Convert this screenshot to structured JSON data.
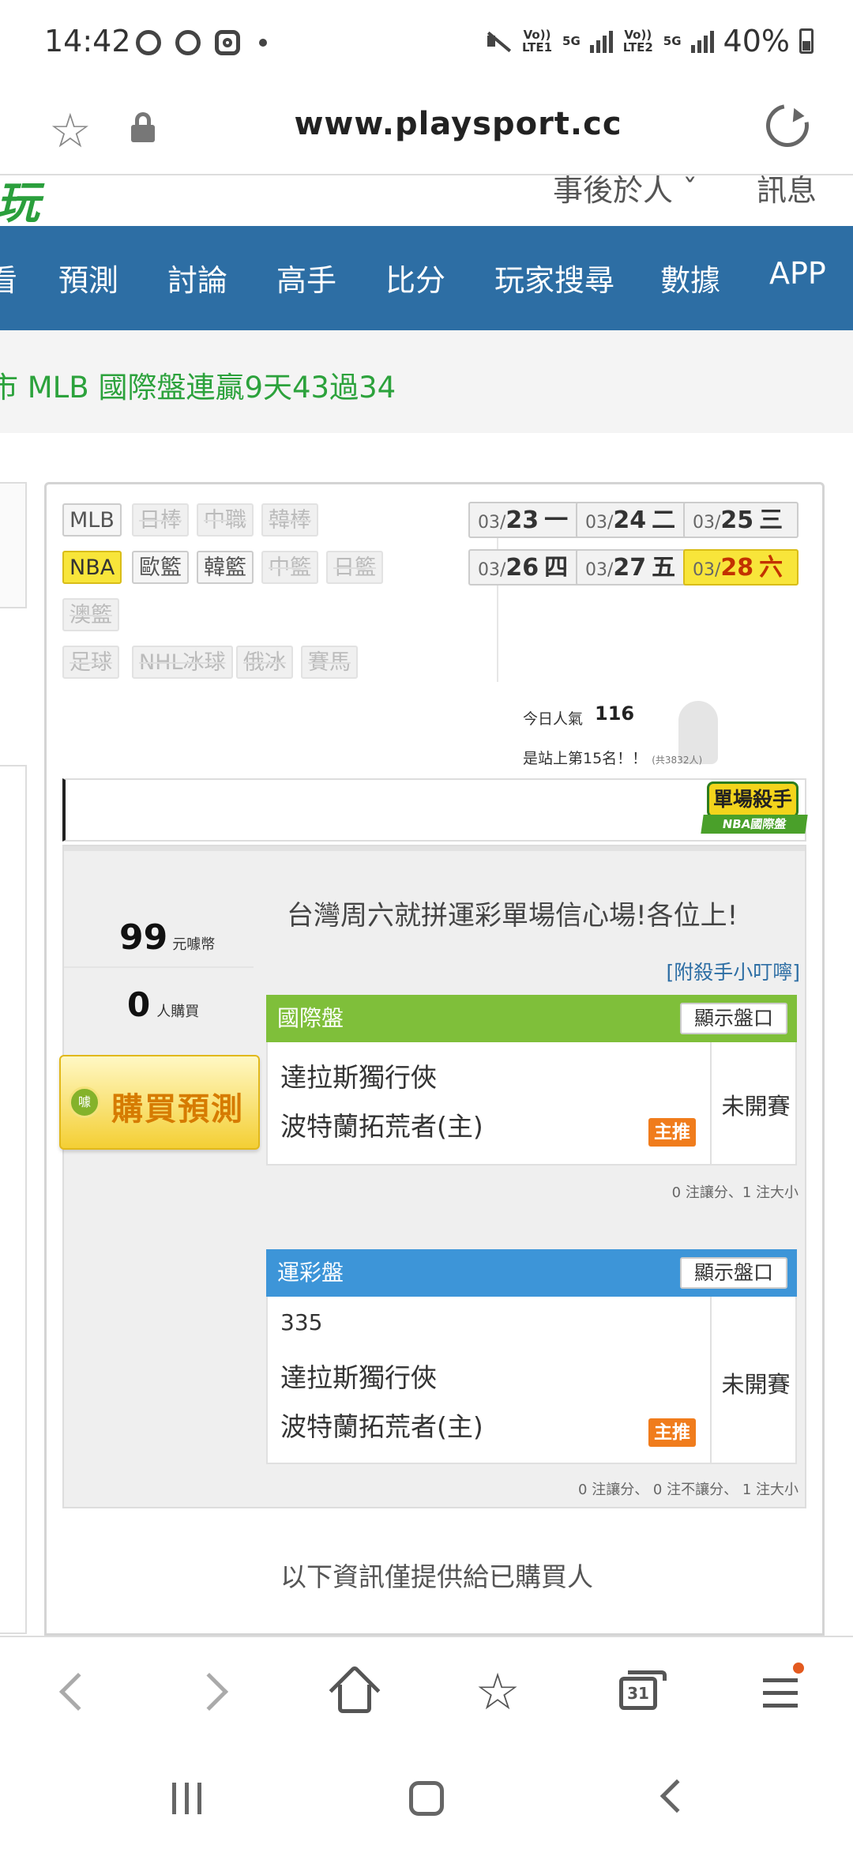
{
  "status_bar": {
    "time": "14:42",
    "sim1": "Vo)) LTE1",
    "sim2": "Vo)) LTE2",
    "net1": "5G",
    "net2": "5G",
    "battery": "40%"
  },
  "browser": {
    "url": "www.playsport.cc"
  },
  "site_header": {
    "link1": "事後於人 ˇ",
    "link2": "訊息"
  },
  "nav": [
    "看",
    "預測",
    "討論",
    "高手",
    "比分",
    "玩家搜尋",
    "數據",
    "APP"
  ],
  "ticker": "市 MLB 國際盤連贏9天43過34",
  "leagues": [
    {
      "label": "MLB",
      "state": "normal"
    },
    {
      "label": "日棒",
      "state": "dim"
    },
    {
      "label": "中職",
      "state": "dim"
    },
    {
      "label": "韓棒",
      "state": "dim"
    },
    {
      "label": "NBA",
      "state": "active"
    },
    {
      "label": "歐籃",
      "state": "normal"
    },
    {
      "label": "韓籃",
      "state": "normal"
    },
    {
      "label": "中籃",
      "state": "dim"
    },
    {
      "label": "日籃",
      "state": "dim"
    },
    {
      "label": "澳籃",
      "state": "dim"
    },
    {
      "label": "足球",
      "state": "dim"
    },
    {
      "label": "NHL冰球",
      "state": "dim"
    },
    {
      "label": "俄冰",
      "state": "dim"
    },
    {
      "label": "賽馬",
      "state": "dim"
    }
  ],
  "dates": [
    {
      "month": "03/",
      "day": "23",
      "weekday": "一",
      "active": false
    },
    {
      "month": "03/",
      "day": "24",
      "weekday": "二",
      "active": false
    },
    {
      "month": "03/",
      "day": "25",
      "weekday": "三",
      "active": false
    },
    {
      "month": "03/",
      "day": "26",
      "weekday": "四",
      "active": false
    },
    {
      "month": "03/",
      "day": "27",
      "weekday": "五",
      "active": false
    },
    {
      "month": "03/",
      "day": "28",
      "weekday": "六",
      "active": true
    }
  ],
  "popularity": {
    "label": "今日人氣",
    "value": "116",
    "rank_text": "是站上第15名！！",
    "rank_total": "(共3832人)"
  },
  "badge": {
    "title": "單場殺手",
    "subtitle": "NBA國際盤"
  },
  "purchase": {
    "price": "99",
    "price_unit": "元噱幣",
    "buyers": "0",
    "buyers_unit": "人購買",
    "coin_text": "噱",
    "button_label": "購買預測"
  },
  "headline": "台灣周六就拼運彩單場信心場!各位上!",
  "killer_link": "[附殺手小叮嚀]",
  "intl_section": {
    "title": "國際盤",
    "show_button": "顯示盤口",
    "away": "達拉斯獨行俠",
    "home": "波特蘭拓荒者(主)",
    "pick_badge": "主推",
    "status": "未開賽",
    "counts": "0 注讓分、1 注大小"
  },
  "lottery_section": {
    "title": "運彩盤",
    "show_button": "顯示盤口",
    "code": "335",
    "away": "達拉斯獨行俠",
    "home": "波特蘭拓荒者(主)",
    "pick_badge": "主推",
    "status": "未開賽",
    "counts": "0 注讓分、 0 注不讓分、 1 注大小"
  },
  "footer_note": "以下資訊僅提供給已購買人",
  "toolbar": {
    "tabs_count": "31"
  }
}
